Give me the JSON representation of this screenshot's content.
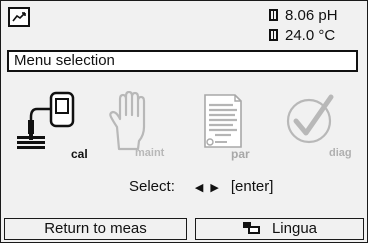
{
  "status": {
    "mode_icon": "measure-mode-icon",
    "ph_value": "8.06 pH",
    "temp_value": "24.0 °C"
  },
  "title": "Menu selection",
  "menu_items": [
    {
      "key": "cal",
      "label": "cal",
      "icon": "sensor-calibration-icon",
      "enabled": true
    },
    {
      "key": "maint",
      "label": "maint",
      "icon": "hand-icon",
      "enabled": false
    },
    {
      "key": "par",
      "label": "par",
      "icon": "document-icon",
      "enabled": false
    },
    {
      "key": "diag",
      "label": "diag",
      "icon": "checkmark-circle-icon",
      "enabled": false
    }
  ],
  "select": {
    "label": "Select:",
    "arrows": "◀ ▶",
    "enter": "[enter]"
  },
  "softkeys": {
    "left": "Return to meas",
    "right": "Lingua",
    "right_icon": "language-icon"
  },
  "colors": {
    "foreground": "#111111",
    "disabled": "#b8b8b8",
    "background": "#f1f1f1"
  }
}
